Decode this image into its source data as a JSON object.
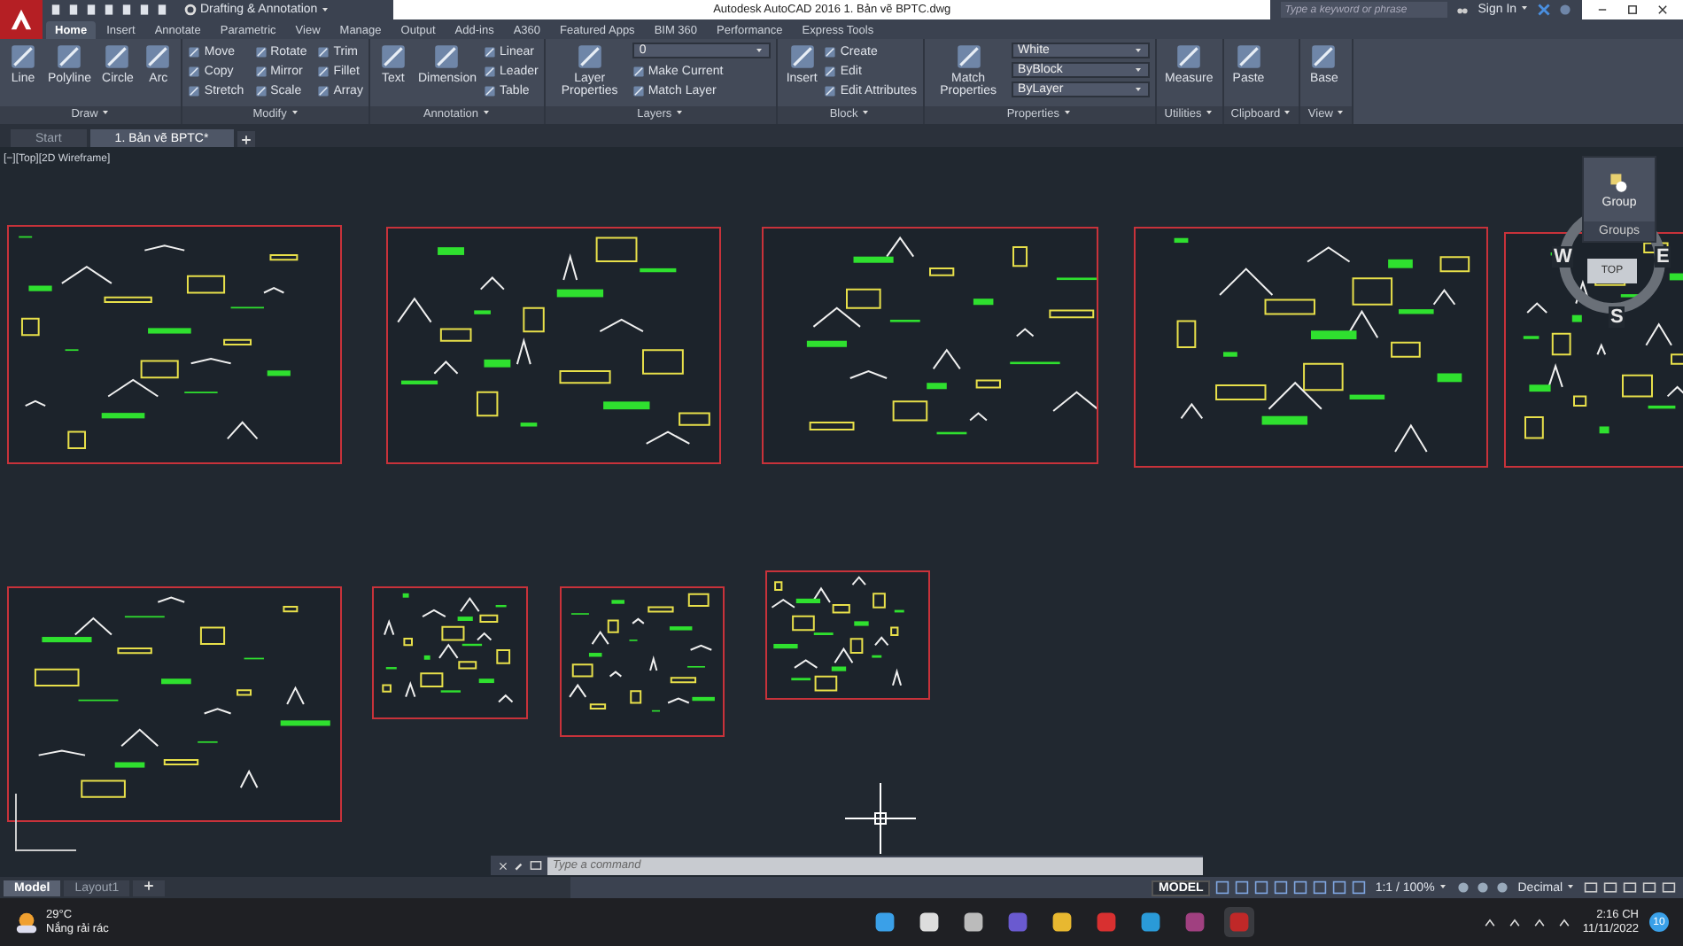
{
  "title_bar": {
    "workspace": "Drafting & Annotation",
    "title": "Autodesk AutoCAD 2016   1. Bản vẽ BPTC.dwg",
    "search": {
      "placeholder": "Type a keyword or phrase"
    },
    "sign_in": "Sign In"
  },
  "ribbon_tabs": [
    {
      "label": "Home",
      "selected": true
    },
    {
      "label": "Insert",
      "selected": false
    },
    {
      "label": "Annotate",
      "selected": false
    },
    {
      "label": "Parametric",
      "selected": false
    },
    {
      "label": "View",
      "selected": false
    },
    {
      "label": "Manage",
      "selected": false
    },
    {
      "label": "Output",
      "selected": false
    },
    {
      "label": "Add-ins",
      "selected": false
    },
    {
      "label": "A360",
      "selected": false
    },
    {
      "label": "Featured Apps",
      "selected": false
    },
    {
      "label": "BIM 360",
      "selected": false
    },
    {
      "label": "Performance",
      "selected": false
    },
    {
      "label": "Express Tools",
      "selected": false
    }
  ],
  "panels": [
    {
      "title": "Draw",
      "tools": [
        {
          "label": "Line",
          "kind": "large"
        },
        {
          "label": "Polyline",
          "kind": "large"
        },
        {
          "label": "Circle",
          "kind": "large"
        },
        {
          "label": "Arc",
          "kind": "large"
        }
      ]
    },
    {
      "title": "Modify",
      "tools": [
        {
          "label": "Move",
          "kind": "small"
        },
        {
          "label": "Copy",
          "kind": "small"
        },
        {
          "label": "Stretch",
          "kind": "small"
        },
        {
          "label": "Rotate",
          "kind": "small"
        },
        {
          "label": "Mirror",
          "kind": "small"
        },
        {
          "label": "Scale",
          "kind": "small"
        },
        {
          "label": "Trim",
          "kind": "small"
        },
        {
          "label": "Fillet",
          "kind": "small"
        },
        {
          "label": "Array",
          "kind": "small"
        }
      ]
    },
    {
      "title": "Annotation",
      "tools": [
        {
          "label": "Text",
          "kind": "large"
        },
        {
          "label": "Dimension",
          "kind": "large"
        },
        {
          "label": "Linear",
          "kind": "small"
        },
        {
          "label": "Leader",
          "kind": "small"
        },
        {
          "label": "Table",
          "kind": "small"
        }
      ]
    },
    {
      "title": "Layers",
      "tools": [
        {
          "label": "Layer Properties",
          "kind": "large"
        },
        {
          "label": "0",
          "kind": "dropdown"
        },
        {
          "label": "Make Current",
          "kind": "small"
        },
        {
          "label": "Match Layer",
          "kind": "small"
        }
      ]
    },
    {
      "title": "Block",
      "tools": [
        {
          "label": "Insert",
          "kind": "large"
        },
        {
          "label": "Create",
          "kind": "small"
        },
        {
          "label": "Edit",
          "kind": "small"
        },
        {
          "label": "Edit Attributes",
          "kind": "small"
        }
      ]
    },
    {
      "title": "Properties",
      "tools": [
        {
          "label": "Match Properties",
          "kind": "large"
        },
        {
          "label": "White",
          "kind": "dropdown"
        },
        {
          "label": "ByBlock",
          "kind": "dropdown"
        },
        {
          "label": "ByLayer",
          "kind": "dropdown"
        }
      ]
    },
    {
      "title": "Utilities",
      "tools": [
        {
          "label": "Measure",
          "kind": "large"
        }
      ]
    },
    {
      "title": "Clipboard",
      "tools": [
        {
          "label": "Paste",
          "kind": "large"
        }
      ]
    },
    {
      "title": "View",
      "tools": [
        {
          "label": "Base",
          "kind": "large"
        }
      ]
    }
  ],
  "file_tabs": [
    {
      "label": "Start",
      "selected": false
    },
    {
      "label": "1. Bản vẽ BPTC*",
      "selected": true
    }
  ],
  "viewport_label": "[−][Top][2D Wireframe]",
  "viewcube": {
    "compass": [
      "W",
      "E",
      "S"
    ],
    "face": "TOP"
  },
  "groups_flyout": {
    "tool": "Group",
    "title": "Groups"
  },
  "command_line": {
    "placeholder": "Type a command"
  },
  "layout_tabs": [
    {
      "label": "Model",
      "selected": true
    },
    {
      "label": "Layout1",
      "selected": false
    }
  ],
  "status_bar": {
    "mode": "MODEL",
    "scale": "1:1 / 100%",
    "units": "Decimal"
  },
  "taskbar": {
    "weather": {
      "temperature": "29°C",
      "condition": "Nắng rải rác"
    },
    "time": "2:16 CH",
    "date": "11/11/2022",
    "notifications": "10"
  }
}
